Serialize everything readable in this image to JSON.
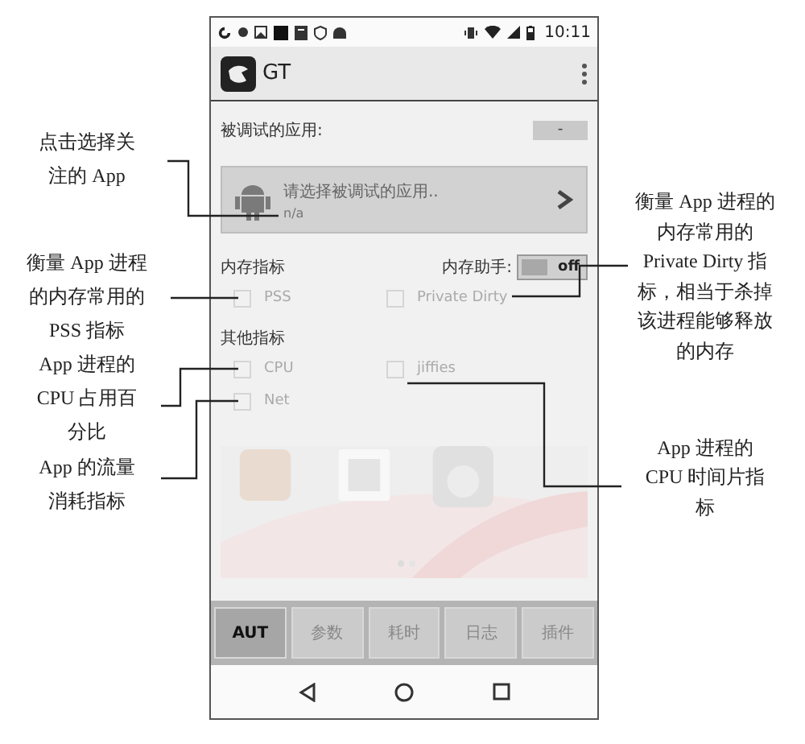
{
  "annotations_left": [
    "点击选择关注的 App",
    "衡量 App 进程的内存常用的PSS 指标",
    "App 进程的CPU 占用百分比",
    "App 的流量消耗指标"
  ],
  "annotations_right": [
    "衡量 App 进程的内存常用的Private Dirty 指标，相当于杀掉该进程能够释放的内存",
    "App 进程的CPU 时间片指标"
  ],
  "status_bar": {
    "time": "10:11"
  },
  "app_bar": {
    "title": "GT"
  },
  "target_app": {
    "label": "被调试的应用:",
    "button": "-",
    "prompt": "请选择被调试的应用..",
    "package": "n/a"
  },
  "memory": {
    "heading": "内存指标",
    "helper_label": "内存助手:",
    "helper_toggle": {
      "label": "off",
      "on": false
    },
    "metrics": [
      {
        "label": "PSS",
        "checked": false
      },
      {
        "label": "Private Dirty",
        "checked": false
      }
    ]
  },
  "other": {
    "heading": "其他指标",
    "metrics": [
      {
        "label": "CPU",
        "checked": false
      },
      {
        "label": "jiffies",
        "checked": false
      },
      {
        "label": "Net",
        "checked": false
      }
    ]
  },
  "tabs": [
    {
      "label": "AUT",
      "selected": true
    },
    {
      "label": "参数",
      "selected": false
    },
    {
      "label": "耗时",
      "selected": false
    },
    {
      "label": "日志",
      "selected": false
    },
    {
      "label": "插件",
      "selected": false
    }
  ]
}
